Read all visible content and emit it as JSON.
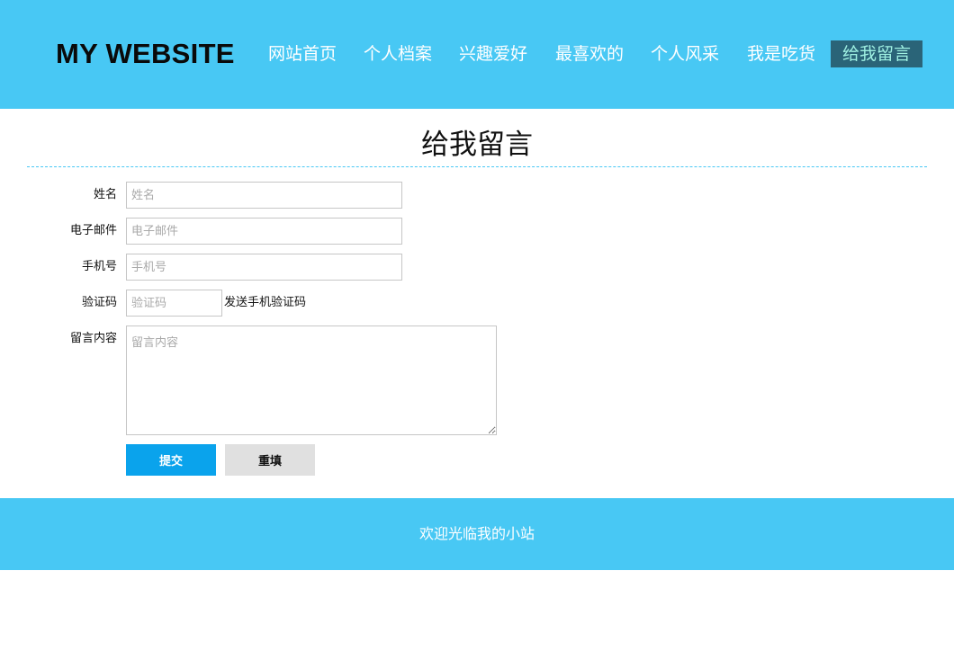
{
  "header": {
    "logo": "MY WEBSITE",
    "nav": [
      {
        "label": "网站首页"
      },
      {
        "label": "个人档案"
      },
      {
        "label": "兴趣爱好"
      },
      {
        "label": "最喜欢的"
      },
      {
        "label": "个人风采"
      },
      {
        "label": "我是吃货"
      },
      {
        "label": "给我留言",
        "active": true
      }
    ]
  },
  "page": {
    "title": "给我留言"
  },
  "form": {
    "name": {
      "label": "姓名",
      "placeholder": "姓名",
      "value": ""
    },
    "email": {
      "label": "电子邮件",
      "placeholder": "电子邮件",
      "value": ""
    },
    "phone": {
      "label": "手机号",
      "placeholder": "手机号",
      "value": ""
    },
    "code": {
      "label": "验证码",
      "placeholder": "验证码",
      "value": "",
      "send_label": "发送手机验证码"
    },
    "message": {
      "label": "留言内容",
      "placeholder": "留言内容",
      "value": ""
    },
    "submit_label": "提交",
    "reset_label": "重填"
  },
  "footer": {
    "text": "欢迎光临我的小站"
  },
  "colors": {
    "brand": "#48c8f4",
    "active_nav_bg": "#2a6478",
    "active_nav_text": "#9ff0e2",
    "submit_bg": "#0aa3ec",
    "reset_bg": "#e0e0e0"
  }
}
